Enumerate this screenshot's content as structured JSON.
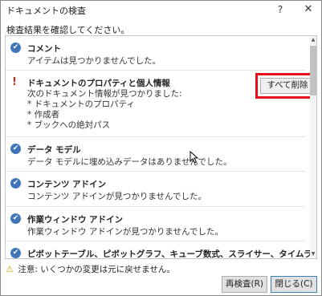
{
  "window": {
    "title": "ドキュメントの検査",
    "help": "?",
    "close": "✕"
  },
  "instruction": "検査結果を確認してください。",
  "results": [
    {
      "status": "ok",
      "name": "コメント",
      "message": "アイテムは見つかりませんでした。"
    },
    {
      "status": "found",
      "name": "ドキュメントのプロパティと個人情報",
      "lines": [
        "次のドキュメント情報が見つかりました:",
        "* ドキュメントのプロパティ",
        "* 作成者",
        "* ブックへの絶対パス"
      ],
      "action": "すべて削除"
    },
    {
      "status": "ok",
      "name": "データ モデル",
      "message": "データ モデルに埋め込みデータはありませんでした。"
    },
    {
      "status": "ok",
      "name": "コンテンツ アドイン",
      "message": "コンテンツ アドインが見つかりませんでした。"
    },
    {
      "status": "ok",
      "name": "作業ウィンドウ アドイン",
      "message": "作業ウィンドウ アドインが見つかりませんでした。"
    },
    {
      "status": "ok",
      "name": "ピボットテーブル、ピボットグラフ、キューブ数式、スライサー、タイムライン",
      "message": ""
    }
  ],
  "footer": {
    "note": "注意: いくつかの変更は元に戻せません。",
    "reinspect": "再検査(R)",
    "close": "閉じる(C)"
  },
  "icons": {
    "check": "✔",
    "warning": "!",
    "triangle": "⚠",
    "scroll_up": "▲",
    "scroll_down": "▼"
  }
}
